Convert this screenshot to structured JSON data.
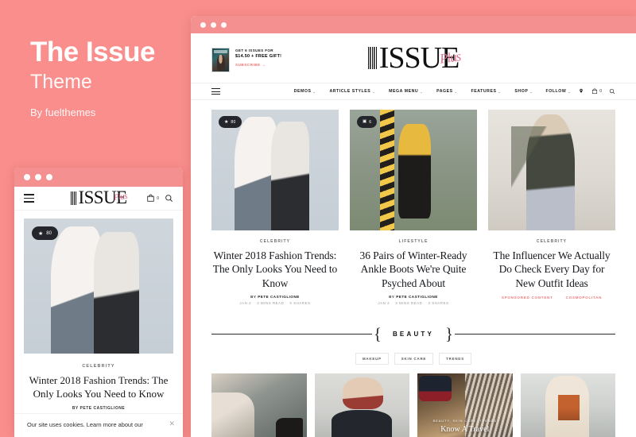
{
  "promo": {
    "title": "The Issue",
    "subtitle": "Theme",
    "byline": "By fuelthemes"
  },
  "colors": {
    "background_pink": "#f98e8c",
    "titlebar_pink": "#f4908f",
    "accent_coral": "#ef6f6c",
    "sponsor_pink": "#ef7b7b",
    "ink": "#16181c"
  },
  "desktop": {
    "titlebar": {
      "dots": [
        "dot-1",
        "dot-2",
        "dot-3"
      ]
    },
    "offer": {
      "line1": "GET 6 ISSUES FOR",
      "line2": "$14.50 + FREE GIFT!",
      "cta": "SUBSCRIBE",
      "cta_arrow": "→",
      "cover_alt": "magazine-cover"
    },
    "logo": {
      "word": "ISSUE",
      "script": "Plus",
      "barcode_text": "THE ISSUE"
    },
    "nav": {
      "menu_icon": "hamburger-icon",
      "items": [
        {
          "label": "DEMOS",
          "caret": "⌄"
        },
        {
          "label": "ARTICLE STYLES",
          "caret": "⌄"
        },
        {
          "label": "MEGA MENU",
          "caret": "⌄"
        },
        {
          "label": "PAGES",
          "caret": "⌄"
        },
        {
          "label": "FEATURES",
          "caret": "⌄"
        },
        {
          "label": "SHOP",
          "caret": "⌄"
        }
      ],
      "follow_label": "FOLLOW",
      "follow_caret": "⌄",
      "cart_count": "0",
      "icons": [
        "pin-icon",
        "cart-icon",
        "search-icon"
      ]
    },
    "featured": [
      {
        "badge_type": "star",
        "badge_icon": "star-icon",
        "badge_value": "80",
        "category": "CELEBRITY",
        "title": "Winter 2018 Fashion Trends: The Only Looks You Need to Know",
        "by_prefix": "BY",
        "author": "PETE CASTIGLIONE",
        "date": "JAN 2",
        "read_time": "3 MINS READ",
        "shares": "0 SHARES",
        "photo": "ph1"
      },
      {
        "badge_type": "photo",
        "badge_icon": "camera-icon",
        "badge_value": "6",
        "category": "LIFESTYLE",
        "title": "36 Pairs of Winter-Ready Ankle Boots We're Quite Psyched About",
        "by_prefix": "BY",
        "author": "PETE CASTIGLIONE",
        "date": "JAN 2",
        "read_time": "3 MINS READ",
        "shares": "3 SHARES",
        "photo": "ph2"
      },
      {
        "badge_type": "none",
        "badge_icon": "",
        "badge_value": "",
        "category": "CELEBRITY",
        "title": "The Influencer We Actually Do Check Every Day for New Outfit Ideas",
        "sponsored_label": "SPONSORED CONTENT",
        "sponsor_name": "COSMOPOLITAN",
        "photo": "ph3"
      }
    ],
    "section": {
      "title": "BEAUTY",
      "brace_left": "{",
      "brace_right": "}",
      "filters": [
        "MAKEUP",
        "SKIN CARE",
        "TRENDS"
      ]
    },
    "beauty_cards": [
      {
        "photo": "ph4",
        "sub": "",
        "caption": ""
      },
      {
        "photo": "ph5",
        "sub": "",
        "caption": ""
      },
      {
        "photo": "ph6",
        "sub": "BEAUTY, SKIN CARE, TRENDS",
        "caption": "Know A Travel"
      },
      {
        "photo": "ph7",
        "sub": "",
        "caption": ""
      }
    ]
  },
  "mobile": {
    "titlebar": {
      "dots": [
        "dot-1",
        "dot-2",
        "dot-3"
      ]
    },
    "menu_icon": "hamburger-icon",
    "logo": {
      "word": "ISSUE",
      "script": "Plus"
    },
    "cart_count": "0",
    "icons": [
      "cart-icon",
      "search-icon"
    ],
    "hero": {
      "badge_icon": "star-icon",
      "badge_value": "80",
      "category": "CELEBRITY",
      "title": "Winter 2018 Fashion Trends: The Only Looks You Need to Know",
      "by_line": "BY PETE CASTIGLIONE",
      "photo": "ph1"
    },
    "cookie": {
      "text": "Our site uses cookies. Learn more about our",
      "close_icon": "close-icon"
    }
  }
}
